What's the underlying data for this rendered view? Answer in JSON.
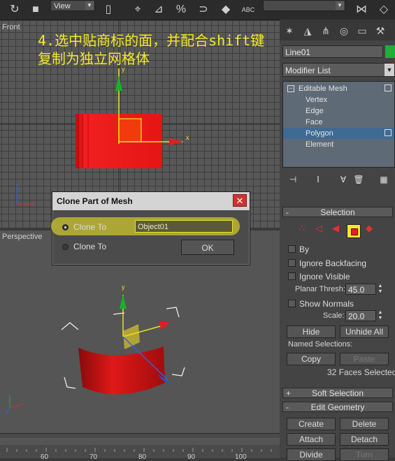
{
  "toolbar": {
    "view_select": "View",
    "icons": [
      "redo-icon",
      "select-object-icon",
      "view-dropdown",
      "isolate-icon",
      "snap-icon",
      "angle-snap-icon",
      "percent-snap-icon",
      "spinner-snap-icon",
      "named-selection-icon",
      "mirror-icon",
      "align-icon"
    ],
    "abc_label": "ABC"
  },
  "viewports": {
    "front": {
      "label": "Front"
    },
    "perspective": {
      "label": "Perspective"
    }
  },
  "overlay": {
    "line1": "4.选中贴商标的面，并配合shift键",
    "line2": "复制为独立网格体"
  },
  "dialog": {
    "title": "Clone Part of Mesh",
    "close_glyph": "✕",
    "option1_label": "Clone To",
    "option2_label": "Clone To",
    "name_value": "Object01",
    "ok_label": "OK"
  },
  "command_panel": {
    "object_name": "Line01",
    "object_color": "#1eae3a",
    "modifier_list": "Modifier List",
    "stack": [
      {
        "label": "Editable Mesh",
        "level": 0,
        "selected": false
      },
      {
        "label": "Vertex",
        "level": 1,
        "selected": false
      },
      {
        "label": "Edge",
        "level": 1,
        "selected": false
      },
      {
        "label": "Face",
        "level": 1,
        "selected": false
      },
      {
        "label": "Polygon",
        "level": 1,
        "selected": true
      },
      {
        "label": "Element",
        "level": 1,
        "selected": false
      }
    ],
    "selection": {
      "header": "Selection",
      "by_label": "By",
      "ignore_backfacing": "Ignore Backfacing",
      "ignore_visible": "Ignore Visible",
      "planar_thresh_label": "Planar Thresh:",
      "planar_thresh_value": "45.0",
      "show_normals": "Show Normals",
      "scale_label": "Scale:",
      "scale_value": "20.0",
      "hide": "Hide",
      "unhide_all": "Unhide All",
      "named_selections": "Named Selections:",
      "copy": "Copy",
      "paste": "Paste",
      "status": "32 Faces Selected"
    },
    "soft_selection_header": "Soft Selection",
    "edit_geometry": {
      "header": "Edit Geometry",
      "create": "Create",
      "delete": "Delete",
      "attach": "Attach",
      "detach": "Detach",
      "divide": "Divide",
      "turn": "Turn"
    }
  },
  "ruler": {
    "ticks": [
      "60",
      "70",
      "80",
      "90",
      "100"
    ]
  },
  "colors": {
    "accent_yellow": "#f3ea28",
    "mesh_red": "#e01818",
    "selection_blue": "#3f6a94"
  }
}
